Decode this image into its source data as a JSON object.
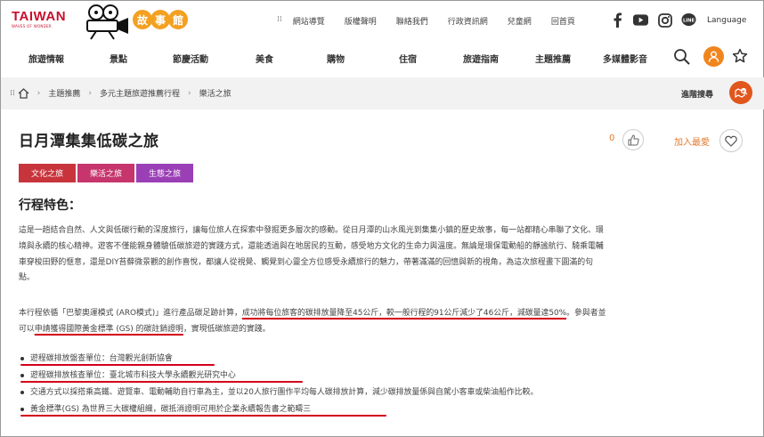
{
  "header": {
    "logo_text": "TAIWAN",
    "logo_sub": "WAVES OF WONDER",
    "story_chars": [
      "故",
      "事",
      "館"
    ],
    "top_links": [
      "網站導覽",
      "版權聲明",
      "聯絡我們",
      "行政資訊網",
      "兒童網",
      "回首頁"
    ],
    "language": "Language",
    "social_icons": [
      "facebook-icon",
      "youtube-icon",
      "instagram-icon",
      "line-icon"
    ]
  },
  "nav": {
    "items": [
      "旅遊情報",
      "景點",
      "節慶活動",
      "美食",
      "購物",
      "住宿",
      "旅遊指南",
      "主題推薦",
      "多媒體影音"
    ]
  },
  "breadcrumb": {
    "items": [
      "主題推薦",
      "多元主題旅遊推薦行程",
      "樂活之旅"
    ],
    "advanced_search": "進階搜尋"
  },
  "article": {
    "title": "日月潭集集低碳之旅",
    "like_count": "0",
    "favorite_label": "加入最愛",
    "tags": [
      {
        "label": "文化之旅",
        "color": "#c8343c"
      },
      {
        "label": "樂活之旅",
        "color": "#c6356c"
      },
      {
        "label": "生態之旅",
        "color": "#9a3fb5"
      }
    ],
    "section_title": "行程特色：",
    "intro": [
      "這是一趟結合自然、人文與低碳行動的深度旅行，讓每位旅人在探索中發掘更多層次的感動。從日月潭的山水風光到集集小鎮的歷史故事，每一站都精心串聯了文化、環",
      "境與永續的核心精神。遊客不僅能親身體驗低碳旅遊的實踐方式，還能透過與在地居民的互動，感受地方文化的生命力與溫度。無論是環保電動船的靜謐航行、騎乘電輔",
      "車穿梭田野的愜意，還是DIY苔蘚微景觀的創作喜悅，都讓人從視覺、觸覺到心靈全方位感受永續旅行的魅力，帶著滿滿的回憶與新的視角，為這次旅程畫下圓滿的句",
      "點。"
    ],
    "aro": {
      "l1_a": "本行程依循「巴黎奧運模式 (ARO模式)」進行產品碳足跡計算，",
      "l1_u": "成功將每位旅客的碳排放量降至45公斤，較一般行程的91公斤減少了46公斤，減碳量達50%",
      "l1_b": "。參與者並",
      "l2_a": "可以",
      "l2_u": "申請獲得國際黃金標準 (GS) 的碳註銷證明",
      "l2_b": "，實現低碳旅遊的實踐。"
    },
    "bullets": [
      "遊程碳排放盤查單位：台灣觀光創新協會",
      "遊程碳排放核查單位：臺北城市科技大學永續觀光研究中心",
      "交通方式以採搭乘高鐵、遊覽車、電動輔助自行車為主，並以20人旅行團作平均每人碳排放計算，減少碳排放量係與自駕小客車或柴油船作比較。",
      "黃金標準(GS) 為世界三大碳權組織，碳抵消證明可用於企業永續報告書之範疇三"
    ]
  }
}
